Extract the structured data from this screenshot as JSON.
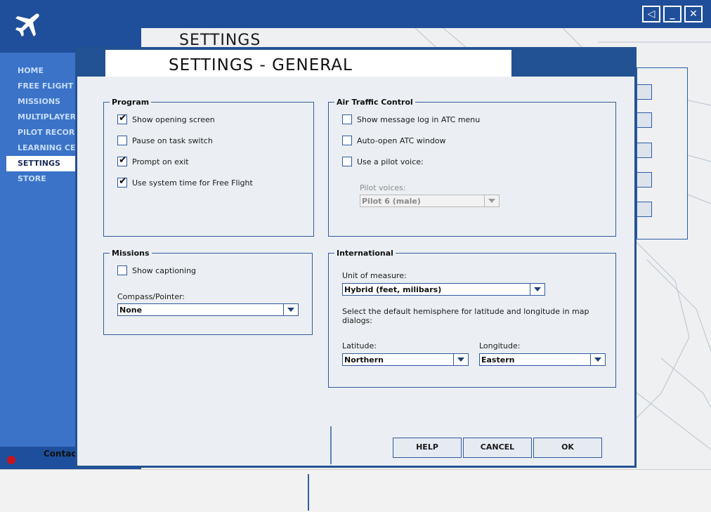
{
  "app": {
    "nav": [
      "HOME",
      "FREE FLIGHT",
      "MISSIONS",
      "MULTIPLAYER",
      "PILOT RECORDS",
      "LEARNING CENTER",
      "SETTINGS",
      "STORE"
    ],
    "active_nav": "SETTINGS",
    "contact_label": "Contac",
    "page_title": "SETTINGS",
    "window_controls": {
      "sound": "◁",
      "minimize": "_",
      "close": "✕"
    }
  },
  "dialog": {
    "title": "SETTINGS - GENERAL",
    "program": {
      "legend": "Program",
      "options": [
        {
          "label": "Show opening screen",
          "checked": true
        },
        {
          "label": "Pause on task switch",
          "checked": false
        },
        {
          "label": "Prompt on exit",
          "checked": true
        },
        {
          "label": "Use system time for Free Flight",
          "checked": true
        }
      ]
    },
    "atc": {
      "legend": "Air Traffic Control",
      "options": [
        {
          "label": "Show message log in ATC menu",
          "checked": false
        },
        {
          "label": "Auto-open ATC window",
          "checked": false
        },
        {
          "label": "Use a pilot voice:",
          "checked": false
        }
      ],
      "pilot_voices_label": "Pilot voices:",
      "pilot_voice_value": "Pilot 6 (male)"
    },
    "missions": {
      "legend": "Missions",
      "show_captioning": {
        "label": "Show captioning",
        "checked": false
      },
      "compass_label": "Compass/Pointer:",
      "compass_value": "None"
    },
    "international": {
      "legend": "International",
      "unit_label": "Unit of measure:",
      "unit_value": "Hybrid (feet, milibars)",
      "hemisphere_text": "Select the default hemisphere for latitude and longitude in map dialogs:",
      "latitude_label": "Latitude:",
      "latitude_value": "Northern",
      "longitude_label": "Longitude:",
      "longitude_value": "Eastern"
    },
    "buttons": {
      "help": "HELP",
      "cancel": "CANCEL",
      "ok": "OK"
    }
  },
  "colors": {
    "header_blue": "#1f4f9a",
    "sidebar_blue": "#3a73c8",
    "dialog_border": "#235293"
  }
}
